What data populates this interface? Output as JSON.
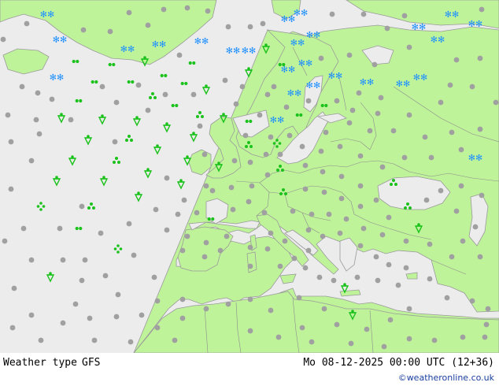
{
  "title": "Weather type",
  "model": "GFS",
  "valid_time": "Mo 08-12-2025 00:00 UTC (12+36)",
  "credit": "©weatheronline.co.uk",
  "colors": {
    "sea": "#ececec",
    "land": "#bff39a",
    "border": "#8c8c8c",
    "coast": "#9a9a9a",
    "rain": "#1cc21c",
    "snow": "#1e90ff",
    "dry": "#a0a0a0"
  },
  "symbol_names": {
    "dot": "dry-dot-icon",
    "shower": "rain-shower-icon",
    "drizzle": "drizzle-icon",
    "rain": "rain-icon",
    "snow": "snow-icon",
    "mixed": "mixed-precip-icon"
  }
}
